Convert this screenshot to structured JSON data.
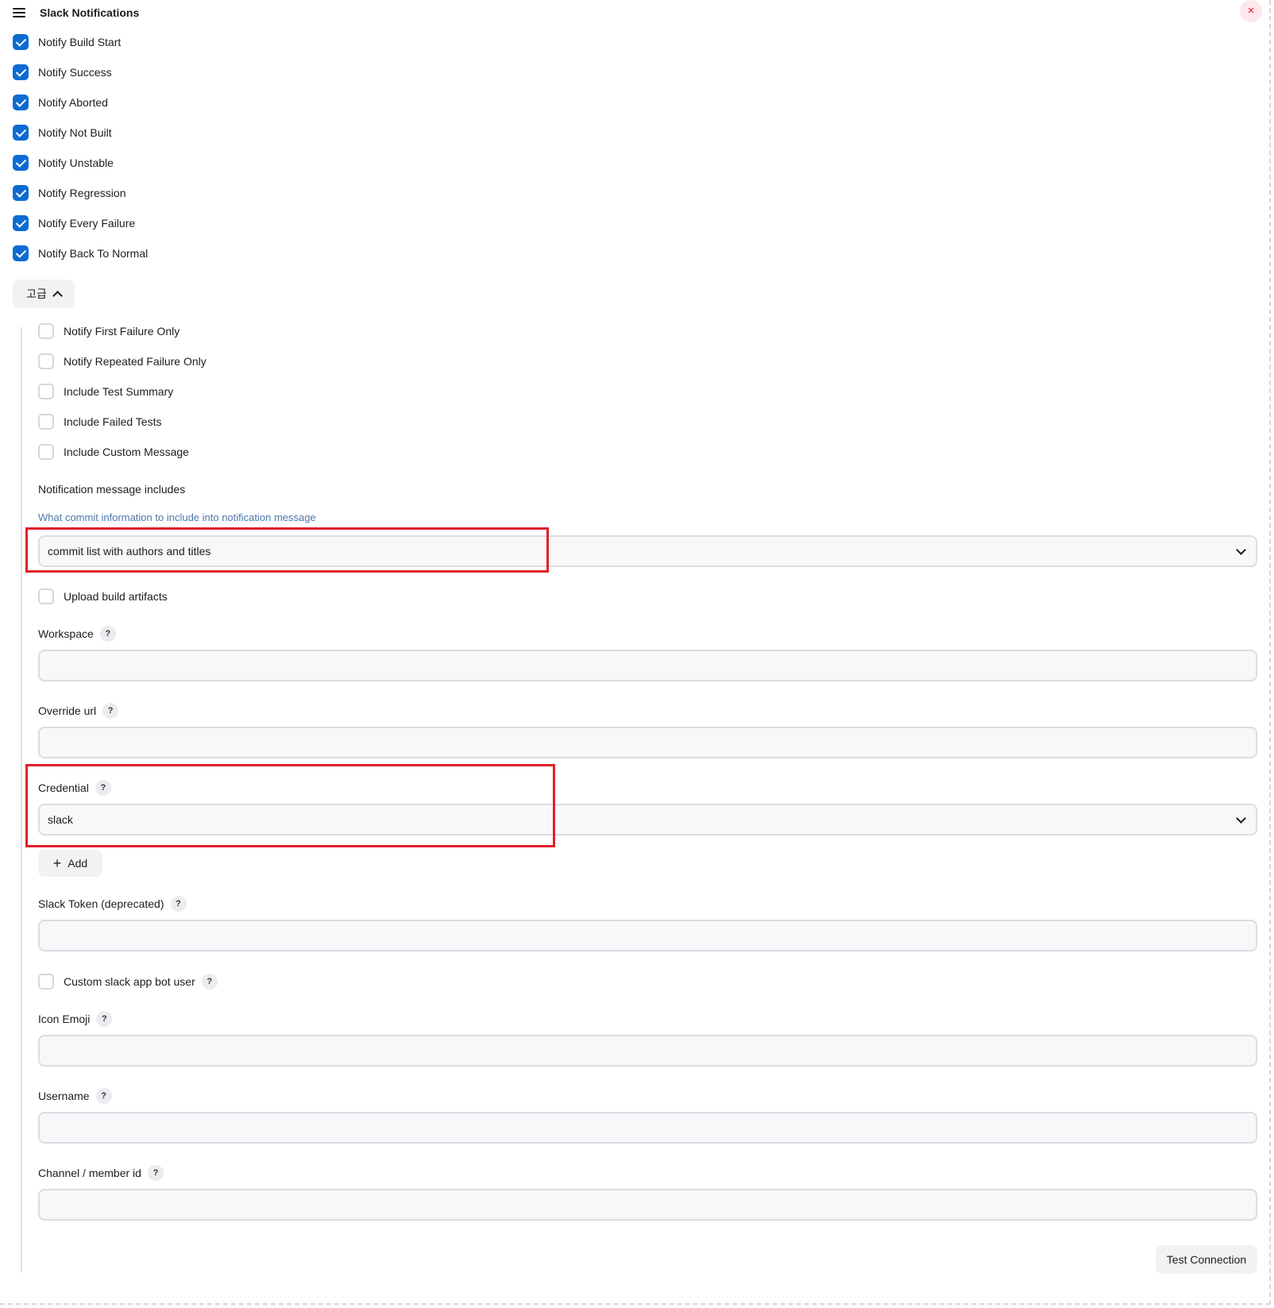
{
  "section": {
    "title": "Slack Notifications",
    "close_symbol": "×"
  },
  "notify_options": [
    {
      "label": "Notify Build Start",
      "checked": true
    },
    {
      "label": "Notify Success",
      "checked": true
    },
    {
      "label": "Notify Aborted",
      "checked": true
    },
    {
      "label": "Notify Not Built",
      "checked": true
    },
    {
      "label": "Notify Unstable",
      "checked": true
    },
    {
      "label": "Notify Regression",
      "checked": true
    },
    {
      "label": "Notify Every Failure",
      "checked": true
    },
    {
      "label": "Notify Back To Normal",
      "checked": true
    }
  ],
  "advanced": {
    "label": "고급",
    "expanded": true
  },
  "advanced_options": [
    {
      "label": "Notify First Failure Only",
      "checked": false
    },
    {
      "label": "Notify Repeated Failure Only",
      "checked": false
    },
    {
      "label": "Include Test Summary",
      "checked": false
    },
    {
      "label": "Include Failed Tests",
      "checked": false
    },
    {
      "label": "Include Custom Message",
      "checked": false
    }
  ],
  "notification_message": {
    "label": "Notification message includes",
    "description": "What commit information to include into notification message",
    "selected": "commit list with authors and titles"
  },
  "upload_artifacts": {
    "label": "Upload build artifacts",
    "checked": false
  },
  "workspace": {
    "label": "Workspace",
    "help": "?",
    "value": ""
  },
  "override_url": {
    "label": "Override url",
    "help": "?",
    "value": ""
  },
  "credential": {
    "label": "Credential",
    "help": "?",
    "selected": "slack"
  },
  "add_button": {
    "label": "Add",
    "icon": "plus-icon"
  },
  "slack_token": {
    "label": "Slack Token (deprecated)",
    "help": "?",
    "value": ""
  },
  "custom_bot_user": {
    "label": "Custom slack app bot user",
    "help": "?",
    "checked": false
  },
  "icon_emoji": {
    "label": "Icon Emoji",
    "help": "?",
    "value": ""
  },
  "username": {
    "label": "Username",
    "help": "?",
    "value": ""
  },
  "channel": {
    "label": "Channel / member id",
    "help": "?",
    "value": ""
  },
  "test_connection": {
    "label": "Test Connection"
  },
  "colors": {
    "accent": "#0b6bd3",
    "highlight": "#e0202b",
    "close": "#e2182c"
  }
}
